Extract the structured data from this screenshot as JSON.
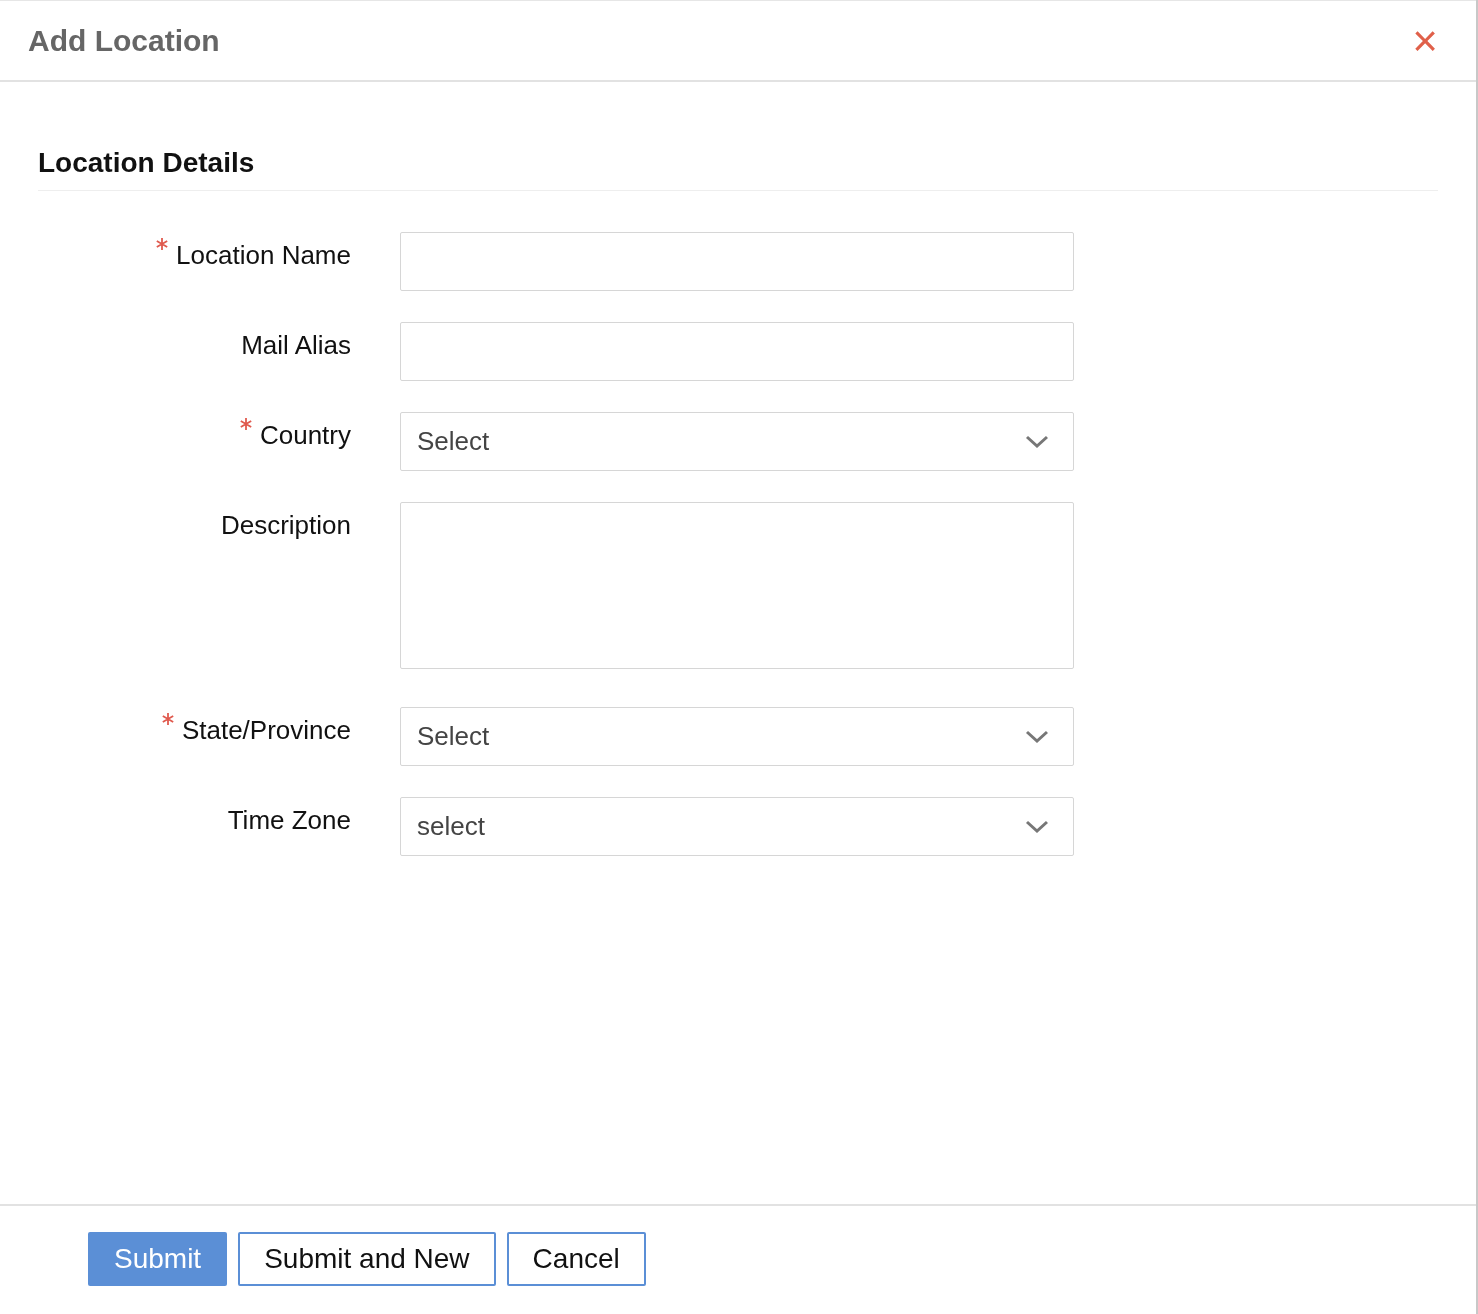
{
  "dialog": {
    "title": "Add Location",
    "close": "×"
  },
  "section": {
    "title": "Location Details"
  },
  "fields": [
    {
      "kind": "text",
      "label": "Location Name",
      "required": true
    },
    {
      "kind": "text",
      "label": "Mail Alias",
      "required": false
    },
    {
      "kind": "select",
      "label": "Country",
      "required": true,
      "value": "Select"
    },
    {
      "kind": "textarea",
      "label": "Description",
      "required": false
    },
    {
      "kind": "select",
      "label": "State/Province",
      "required": true,
      "value": "Select"
    },
    {
      "kind": "select",
      "label": "Time Zone",
      "required": false,
      "value": "select"
    }
  ],
  "buttons": [
    {
      "kind": "primary",
      "label": "Submit"
    },
    {
      "kind": "secondary",
      "label": "Submit and New"
    },
    {
      "kind": "secondary",
      "label": "Cancel"
    }
  ]
}
